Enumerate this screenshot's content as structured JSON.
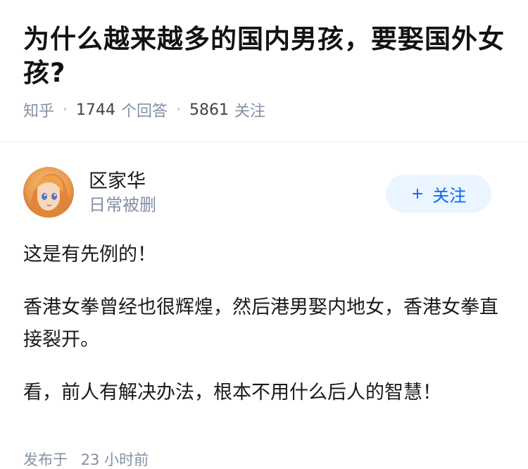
{
  "question": {
    "title": "为什么越来越多的国内男孩，要娶国外女孩?",
    "source": "知乎",
    "answer_count": "1744",
    "answer_label": "个回答",
    "follower_count": "5861",
    "follower_label": "关注"
  },
  "author": {
    "name": "区家华",
    "bio": "日常被删",
    "avatar_icon": "avatar-anime-girl",
    "follow_plus": "+",
    "follow_label": "关注"
  },
  "answer": {
    "paragraphs": [
      "这是有先例的！",
      "香港女拳曾经也很辉煌，然后港男娶内地女，香港女拳直接裂开。",
      "看，前人有解决办法，根本不用什么后人的智慧！"
    ],
    "published_label": "发布于",
    "published_time": "23 小时前"
  },
  "colors": {
    "accent": "#0066ff",
    "follow_bg": "#ebf5ff",
    "meta_gray": "#8590a6"
  }
}
